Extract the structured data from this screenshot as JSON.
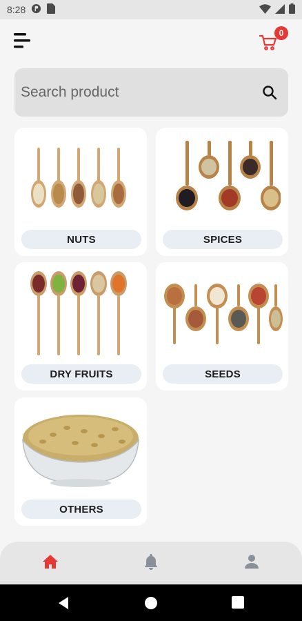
{
  "status_bar": {
    "time": "8:28"
  },
  "header": {
    "cart_count": "0",
    "cart_color": "#e53935"
  },
  "search": {
    "placeholder": "Search product"
  },
  "categories": [
    {
      "label": "NUTS"
    },
    {
      "label": "SPICES"
    },
    {
      "label": "DRY FRUITS"
    },
    {
      "label": "SEEDS"
    },
    {
      "label": "OTHERS"
    }
  ],
  "bottom_nav": {
    "items": [
      {
        "icon": "home-icon",
        "active": true,
        "color": "#e53935"
      },
      {
        "icon": "bell-icon",
        "active": false,
        "color": "#8a9099"
      },
      {
        "icon": "person-icon",
        "active": false,
        "color": "#8a9099"
      }
    ]
  }
}
